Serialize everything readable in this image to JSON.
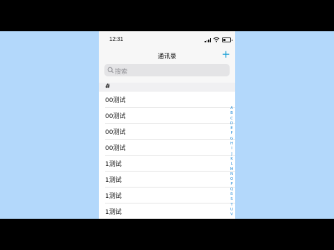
{
  "status_bar": {
    "time": "12:31"
  },
  "navbar": {
    "title": "通讯录",
    "add_label": "+"
  },
  "search": {
    "placeholder": "搜索"
  },
  "section": {
    "title": "#"
  },
  "contacts": [
    "00测试",
    "00测试",
    "00测试",
    "00测试",
    "1测试",
    "1测试",
    "1测试",
    "1测试"
  ],
  "index_letters": [
    "A",
    "B",
    "C",
    "D",
    "E",
    "F",
    "G",
    "H",
    "I",
    "J",
    "K",
    "L",
    "M",
    "N",
    "O",
    "P",
    "Q",
    "R",
    "S",
    "T",
    "U",
    "V"
  ],
  "colors": {
    "accent": "#1aa0d6",
    "background": "#b3d8fb"
  }
}
